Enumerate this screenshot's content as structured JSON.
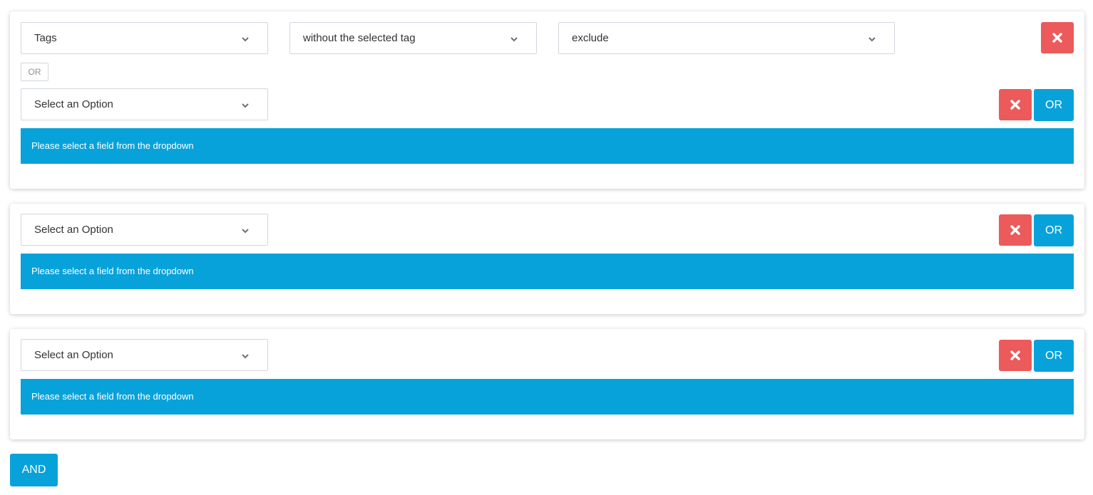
{
  "groups": [
    {
      "rows": [
        {
          "field": "Tags",
          "operator": "without the selected tag",
          "value": "exclude"
        }
      ],
      "or_tag": "OR",
      "pending": {
        "field": "Select an Option",
        "info": "Please select a field from the dropdown",
        "or_button": "OR"
      }
    },
    {
      "pending": {
        "field": "Select an Option",
        "info": "Please select a field from the dropdown",
        "or_button": "OR"
      }
    },
    {
      "pending": {
        "field": "Select an Option",
        "info": "Please select a field from the dropdown",
        "or_button": "OR"
      }
    }
  ],
  "and_button": "AND",
  "icons": {
    "remove": "close-icon",
    "dropdown": "chevron-down-icon"
  },
  "colors": {
    "primary": "#08a2da",
    "danger": "#ec5a5b",
    "border": "#d2d6de"
  }
}
